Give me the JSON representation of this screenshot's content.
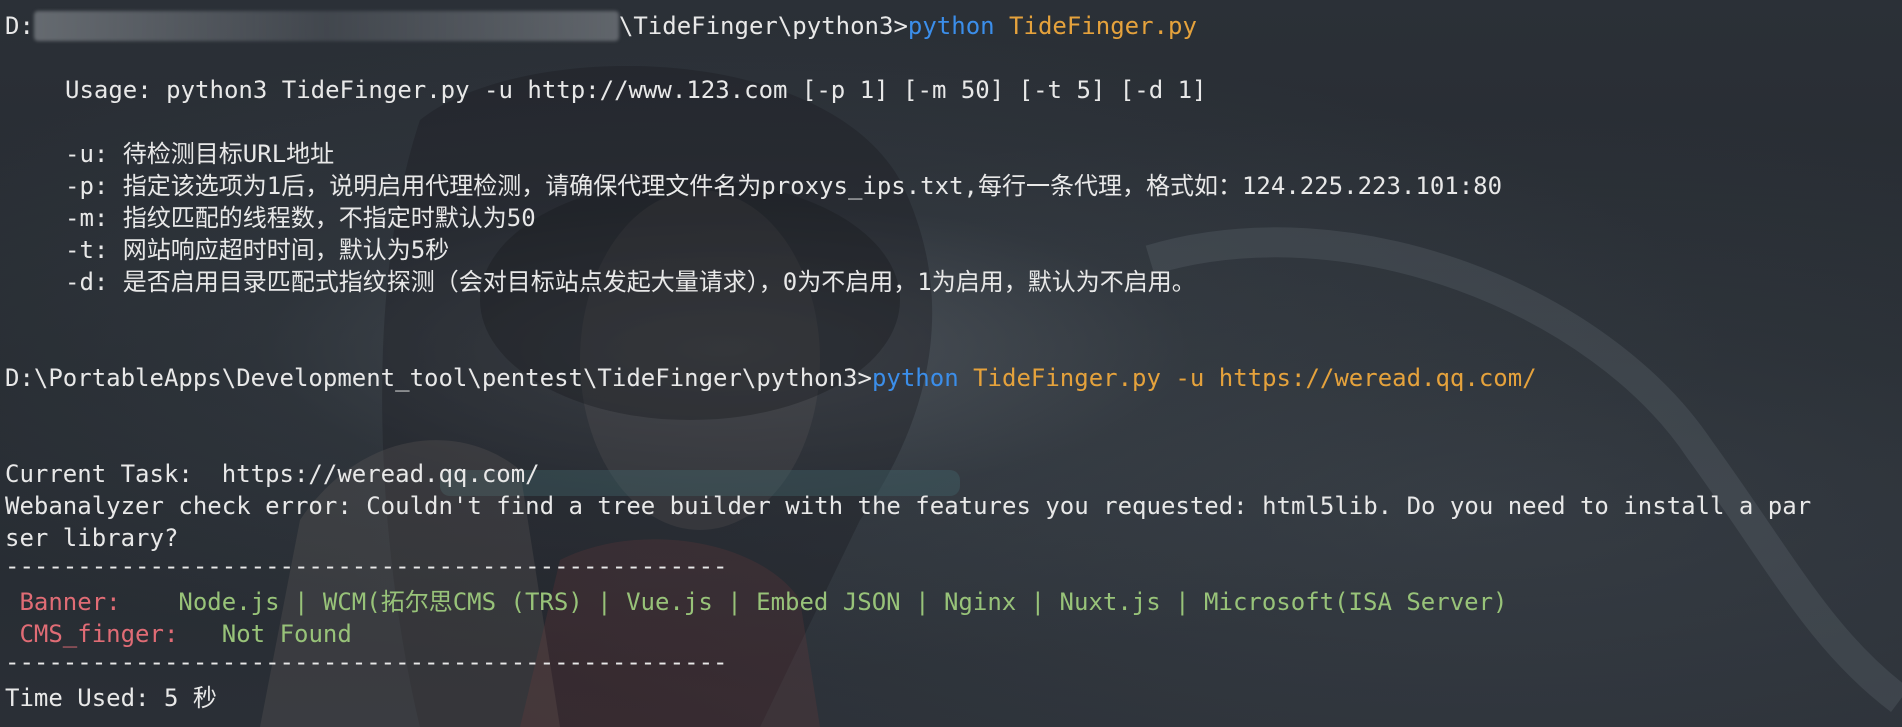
{
  "terminal": {
    "prompt1": {
      "drive": "D:",
      "path_tail": "\\TideFinger\\python3>",
      "cmd_python": "python",
      "cmd_script": "TideFinger.py"
    },
    "usage": "Usage: python3 TideFinger.py -u http://www.123.com [-p 1] [-m 50] [-t 5] [-d 1]",
    "options": [
      "-u: 待检测目标URL地址",
      "-p: 指定该选项为1后，说明启用代理检测，请确保代理文件名为proxys_ips.txt,每行一条代理，格式如：124.225.223.101:80",
      "-m: 指纹匹配的线程数，不指定时默认为50",
      "-t: 网站响应超时时间，默认为5秒",
      "-d: 是否启用目录匹配式指纹探测（会对目标站点发起大量请求），0为不启用，1为启用，默认为不启用。"
    ],
    "prompt2": {
      "path": "D:\\PortableApps\\Development_tool\\pentest\\TideFinger\\python3>",
      "cmd_python": "python",
      "cmd_args": "TideFinger.py -u https://weread.qq.com/"
    },
    "current_task": "Current Task:  https://weread.qq.com/",
    "error_line1": "Webanalyzer check error: Couldn't find a tree builder with the features you requested: html5lib. Do you need to install a par",
    "error_line2": "ser library?",
    "divider": "--------------------------------------------------",
    "banner_label": "Banner:",
    "banner_value": "Node.js | WCM(拓尔思CMS (TRS) | Vue.js | Embed JSON | Nginx | Nuxt.js | Microsoft(ISA Server)",
    "cms_label": "CMS_finger:",
    "cms_value": "Not Found",
    "time_used": "Time Used: 5 秒"
  },
  "colors": {
    "command": "#3b8eea",
    "argument": "#e5a23c",
    "label": "#e06c75",
    "value": "#98c379"
  }
}
